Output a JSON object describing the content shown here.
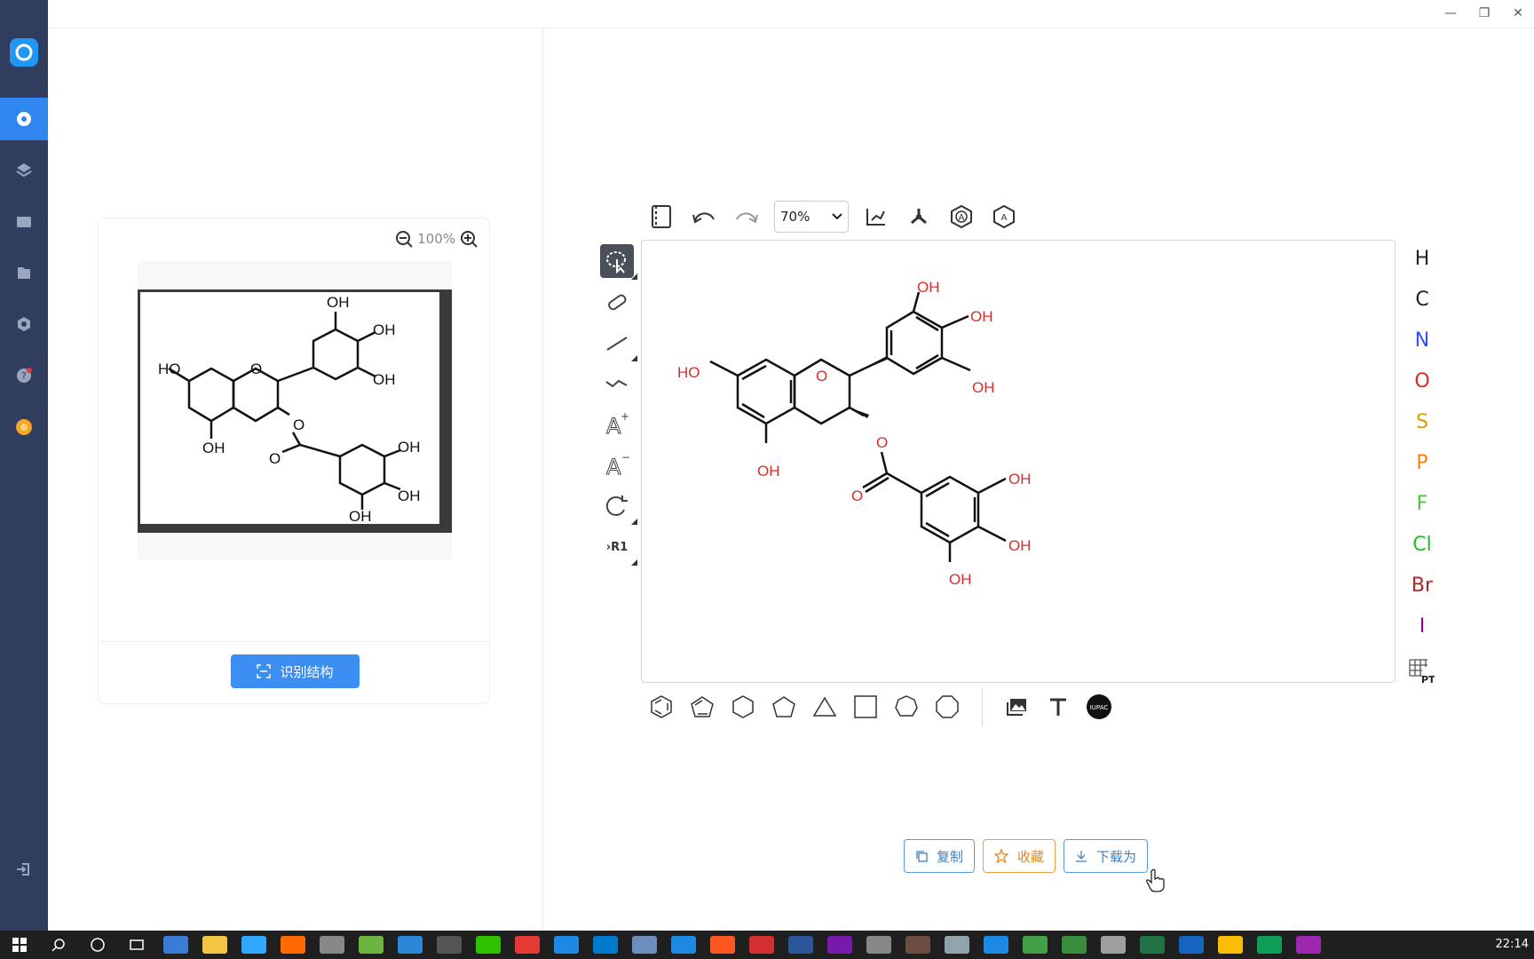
{
  "window": {
    "minimize": "—",
    "restore": "❐",
    "close": "✕"
  },
  "sidebar": {
    "items": [
      {
        "name": "molecule",
        "icon": "molecule-icon",
        "active": true
      },
      {
        "name": "layers",
        "icon": "layers-icon"
      },
      {
        "name": "folder",
        "icon": "folder-icon"
      },
      {
        "name": "file",
        "icon": "file-icon"
      },
      {
        "name": "settings",
        "icon": "gear-icon"
      },
      {
        "name": "help",
        "icon": "help-icon",
        "badge": true
      },
      {
        "name": "coin",
        "icon": "coin-icon"
      }
    ],
    "logout_icon": "logout-icon"
  },
  "left_panel": {
    "zoom_level": "100%",
    "recognize_label": "识别结构",
    "image_labels": [
      "OH",
      "OH",
      "OH",
      "HO",
      "O",
      "O",
      "OH",
      "O",
      "OH",
      "OH",
      "OH"
    ]
  },
  "editor": {
    "zoom_value": "70%",
    "toolbar_icons": [
      "template-icon",
      "undo-icon",
      "redo-icon",
      "layout-icon",
      "clean-icon",
      "aromatize-icon",
      "dearomatize-icon"
    ],
    "left_tools": [
      "select-icon",
      "eraser-icon",
      "bond-icon",
      "chain-icon",
      "charge-plus-icon",
      "charge-minus-icon",
      "rotate-icon",
      "rgroup-icon"
    ],
    "rgroup_label": "R1",
    "atom_labels": {
      "oh_top": "OH",
      "oh_right1": "OH",
      "oh_right2": "OH",
      "ho_left": "HO",
      "o_ring": "O",
      "oh_bottom": "OH",
      "o_ester": "O",
      "o_carbonyl": "O",
      "oh_g1": "OH",
      "oh_g2": "OH",
      "oh_g3": "OH"
    },
    "elements": [
      {
        "symbol": "H",
        "color": "#222222"
      },
      {
        "symbol": "C",
        "color": "#222222"
      },
      {
        "symbol": "N",
        "color": "#3050f8"
      },
      {
        "symbol": "O",
        "color": "#e02a2a"
      },
      {
        "symbol": "S",
        "color": "#d4a000"
      },
      {
        "symbol": "P",
        "color": "#ff8000"
      },
      {
        "symbol": "F",
        "color": "#50c040"
      },
      {
        "symbol": "Cl",
        "color": "#20c020"
      },
      {
        "symbol": "Br",
        "color": "#a62929"
      },
      {
        "symbol": "I",
        "color": "#940094"
      }
    ],
    "periodic_table_label": "PT",
    "bottom_shapes": [
      "benzene-icon",
      "cyclopentadiene-icon",
      "cyclohexane-icon",
      "cyclopentane-icon",
      "cyclopropane-icon",
      "cyclobutane-icon",
      "cycloheptane-icon",
      "cyclooctane-icon"
    ],
    "bottom_tools": [
      "image-icon",
      "text-icon",
      "iupac-icon"
    ],
    "iupac_label": "IUPAC"
  },
  "actions": {
    "copy_label": "复制",
    "favorite_label": "收藏",
    "download_label": "下载为"
  },
  "taskbar": {
    "time": "22:14",
    "apps": [
      "windows-icon",
      "search-icon",
      "cortana-icon",
      "taskview-icon",
      "app-icon",
      "explorer-icon",
      "photoshop-icon",
      "illustrator-icon",
      "app-icon",
      "app-icon",
      "app-icon",
      "en-icon",
      "wechat-icon",
      "app-icon",
      "app-icon",
      "vscode-icon",
      "app-icon",
      "app-icon",
      "app-icon",
      "wps-icon",
      "word-icon",
      "onenote-icon",
      "app-icon",
      "app-icon",
      "app-icon",
      "app-icon",
      "app-icon",
      "app-icon",
      "app-icon",
      "excel-icon",
      "app-icon",
      "chrome-icon",
      "edge-icon",
      "app-icon"
    ]
  }
}
